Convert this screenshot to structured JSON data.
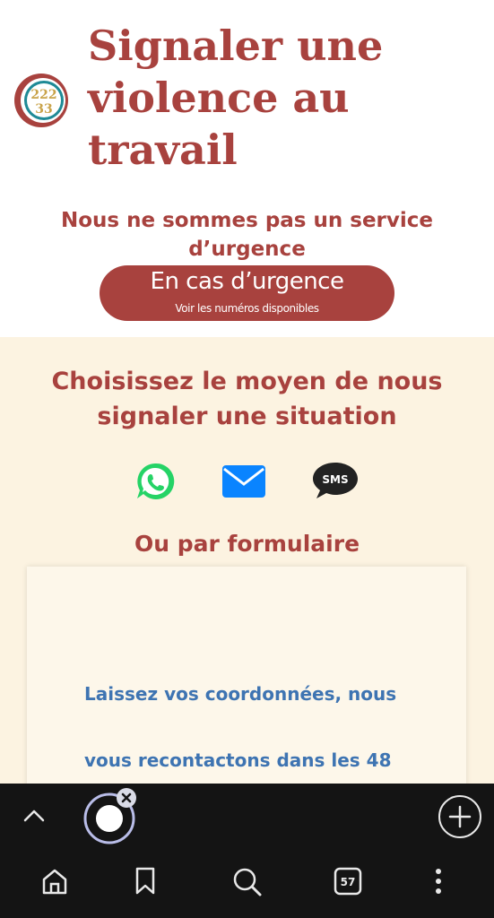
{
  "header": {
    "title_lines": [
      "Signaler une",
      "violence au",
      "travail"
    ],
    "logo_text": [
      "222",
      "33"
    ],
    "notice_lines": [
      "Nous ne sommes pas un service",
      "d’urgence"
    ],
    "urgence_button": {
      "label": "En cas d’urgence",
      "sublabel": "Voir les numéros disponibles"
    }
  },
  "report": {
    "heading_lines": [
      "Choisissez le moyen de nous",
      "signaler une situation"
    ],
    "channels": [
      {
        "name": "WhatsApp",
        "icon": "whatsapp-icon",
        "color": "#25d366"
      },
      {
        "name": "E-mail",
        "icon": "mail-icon",
        "color": "#0a84ff"
      },
      {
        "name": "SMS",
        "icon": "sms-icon",
        "label": "SMS",
        "color": "#222222"
      }
    ],
    "or_form_label": "Ou par formulaire",
    "form_text_lines": [
      "Laissez vos coordonnées, nous",
      "vous recontactons dans les 48"
    ]
  },
  "browser_bar": {
    "tab_count": "57",
    "icons": [
      "chevron-up-icon",
      "assistant-orb-icon",
      "close-icon",
      "plus-icon",
      "home-icon",
      "bookmark-icon",
      "search-icon",
      "tabs-icon",
      "more-icon"
    ]
  },
  "colors": {
    "brand_red": "#a8423e",
    "cream": "#fcf3e1",
    "link_blue": "#3e74b2",
    "toolbar": "#141414"
  }
}
